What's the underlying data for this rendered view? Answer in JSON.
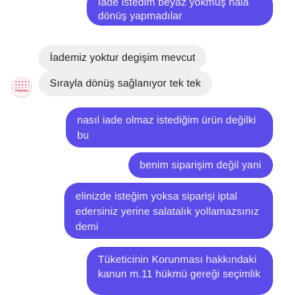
{
  "messages": [
    {
      "id": "m1",
      "side": "out",
      "text": "İade istedim beyaz yokmuş hala dönüş yapmadılar"
    },
    {
      "id": "m2",
      "side": "in",
      "text": "İademiz yoktur degişim mevcut"
    },
    {
      "id": "m3",
      "side": "in",
      "text": "Sırayla dönüş sağlanıyor tek tek"
    },
    {
      "id": "m4",
      "side": "out",
      "text": "nasıl iade olmaz istediğim ürün değilki bu"
    },
    {
      "id": "m5",
      "side": "out",
      "text": "benim siparişim değil yani"
    },
    {
      "id": "m6",
      "side": "out",
      "text": "elinizde isteğim yoksa siparişi iptal edersiniz yerine salatalık yollamazsınız demi"
    },
    {
      "id": "m7",
      "side": "out",
      "text": "Tüketicinin Korunması hakkındaki kanun m.11 hükmü gereği seçimlik"
    }
  ],
  "avatar": {
    "icon": "shop-logo-icon",
    "tag": "Pajama"
  },
  "colors": {
    "outgoing": "#5b4be8",
    "incoming": "#efefef",
    "background": "#ffffff"
  }
}
